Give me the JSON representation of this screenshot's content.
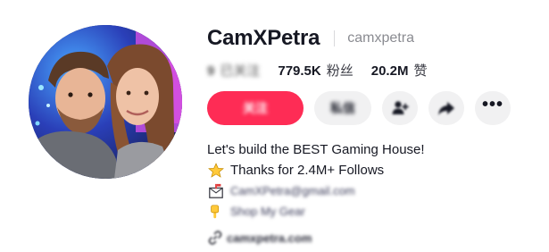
{
  "profile": {
    "display_name": "CamXPetra",
    "username": "camxpetra"
  },
  "stats": {
    "following": {
      "value": "9",
      "label": "已关注"
    },
    "followers": {
      "value": "779.5K",
      "label": "粉丝"
    },
    "likes": {
      "value": "20.2M",
      "label": "赞"
    }
  },
  "actions": {
    "primary_label": "关注",
    "secondary_label": "私信",
    "icons": [
      "add-friend-icon",
      "share-icon",
      "more-options-icon"
    ],
    "more_label": "•••"
  },
  "bio": {
    "line1": "Let's build the BEST Gaming House!",
    "line2": "Thanks for 2.4M+ Follows",
    "email": "CamXPetra@gmail.com",
    "shop": "Shop My Gear",
    "line2_icon": "star-icon",
    "email_icon": "mailbox-icon",
    "shop_icon": "pointing-down-icon"
  },
  "link": {
    "text": "camxpetra.com",
    "icon": "link-icon"
  },
  "colors": {
    "primary": "#fe2c55",
    "secondary_bg": "#f1f1f2",
    "text": "#161823",
    "muted": "#8a8b91"
  }
}
